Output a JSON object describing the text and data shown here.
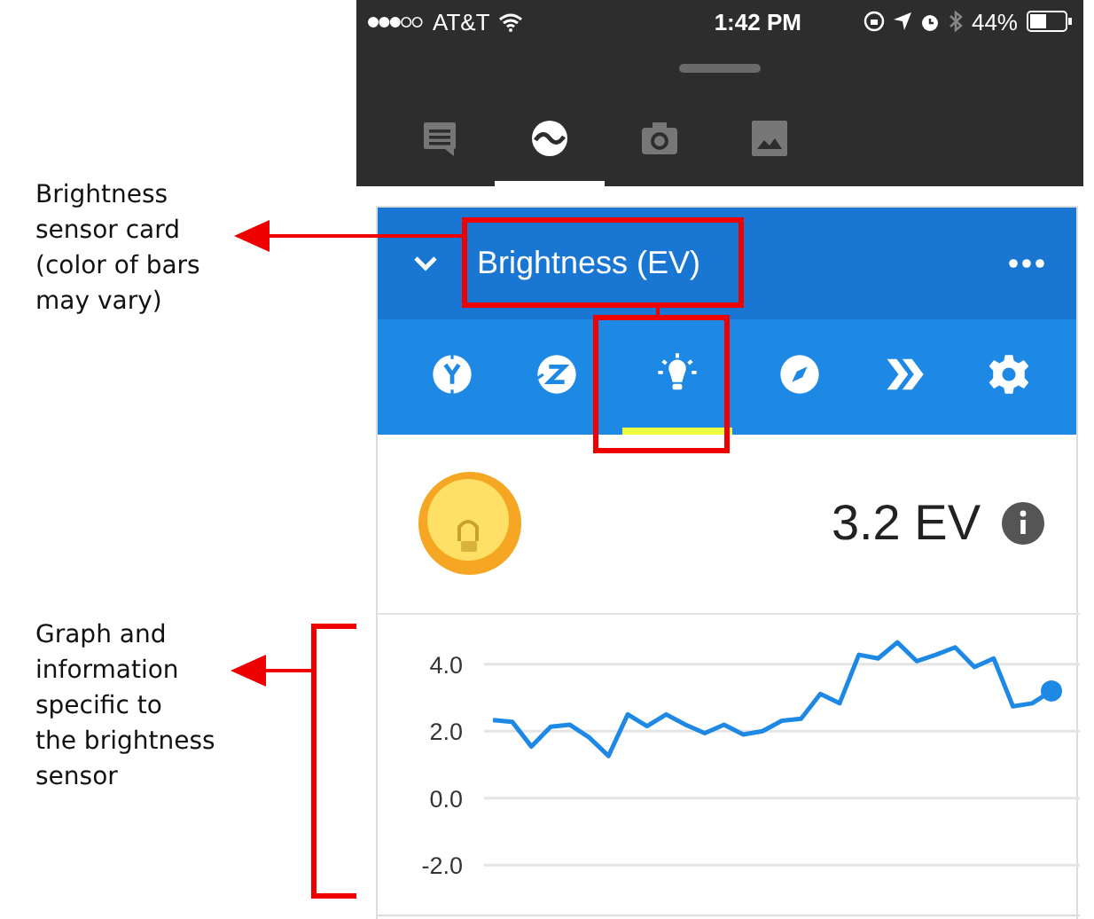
{
  "annotations": [
    {
      "text": "Brightness\nsensor card\n(color of bars\nmay vary)"
    },
    {
      "text": "Graph and\ninformation\nspecific to\nthe brightness\nsensor"
    }
  ],
  "status_bar": {
    "carrier": "AT&T",
    "time": "1:42 PM",
    "battery": "44%"
  },
  "app_tabs": [
    {
      "selected": false
    },
    {
      "selected": true
    },
    {
      "selected": false
    },
    {
      "selected": false
    }
  ],
  "card": {
    "title": "Brightness (EV)",
    "sensor_tabs": [
      {
        "selected": false
      },
      {
        "selected": false
      },
      {
        "selected": true
      },
      {
        "selected": false
      },
      {
        "selected": false
      },
      {
        "selected": false
      }
    ],
    "reading": "3.2 EV",
    "chart_data": {
      "type": "line",
      "yticks": [
        {
          "value": 4,
          "label": "4.0"
        },
        {
          "value": 2,
          "label": "2.0"
        },
        {
          "value": 0,
          "label": "0.0"
        },
        {
          "value": -2,
          "label": "-2.0"
        }
      ],
      "grid": true,
      "ylim": [
        -3.5,
        5.5
      ],
      "series": [
        {
          "color": "#1e88e5",
          "values": [
            2.33,
            2.28,
            1.54,
            2.13,
            2.19,
            1.81,
            1.26,
            2.5,
            2.15,
            2.5,
            2.19,
            1.94,
            2.19,
            1.9,
            2.0,
            2.31,
            2.37,
            3.11,
            2.83,
            4.28,
            4.17,
            4.65,
            4.09,
            4.28,
            4.5,
            3.91,
            4.17,
            2.74,
            2.83,
            3.2
          ]
        }
      ]
    }
  }
}
